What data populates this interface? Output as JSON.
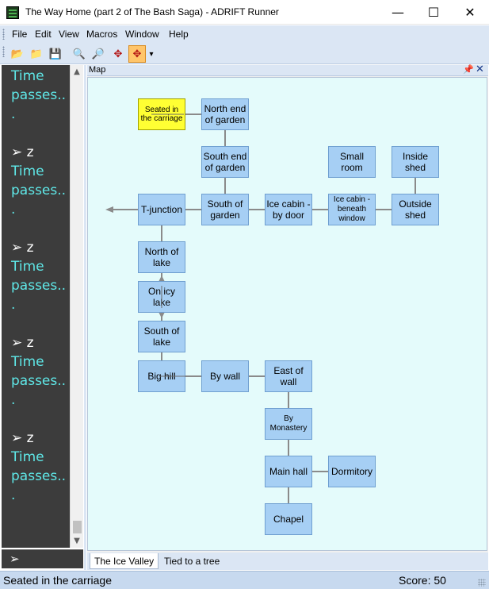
{
  "window": {
    "title": "The Way Home (part 2 of The Bash Saga) - ADRIFT Runner",
    "minimize_glyph": "—",
    "maximize_glyph": "☐",
    "close_glyph": "✕"
  },
  "menu": [
    "File",
    "Edit",
    "View",
    "Macros",
    "Window",
    "Help"
  ],
  "toolbar": {
    "buttons": [
      {
        "icon": "open-folder-icon",
        "glyph": "📂"
      },
      {
        "icon": "open-file-icon",
        "glyph": "📁"
      },
      {
        "icon": "save-icon",
        "glyph": "💾"
      },
      {
        "icon": "zoom-in-icon",
        "glyph": "🔍"
      },
      {
        "icon": "zoom-out-icon",
        "glyph": "🔎"
      },
      {
        "icon": "map-fit-icon",
        "glyph": "✥"
      },
      {
        "icon": "map-center-icon",
        "glyph": "✥"
      }
    ],
    "overflow_glyph": "▾"
  },
  "output": {
    "lines": [
      {
        "text": "Time",
        "type": "response"
      },
      {
        "text": "passes..",
        "type": "response"
      },
      {
        "text": ".",
        "type": "response"
      },
      {
        "text": "",
        "type": "blank"
      },
      {
        "text": "➢ z",
        "type": "cmd"
      },
      {
        "text": "Time",
        "type": "response"
      },
      {
        "text": "passes..",
        "type": "response"
      },
      {
        "text": ".",
        "type": "response"
      },
      {
        "text": "",
        "type": "blank"
      },
      {
        "text": "➢ z",
        "type": "cmd"
      },
      {
        "text": "Time",
        "type": "response"
      },
      {
        "text": "passes..",
        "type": "response"
      },
      {
        "text": ".",
        "type": "response"
      },
      {
        "text": "",
        "type": "blank"
      },
      {
        "text": "➢ z",
        "type": "cmd"
      },
      {
        "text": "Time",
        "type": "response"
      },
      {
        "text": "passes..",
        "type": "response"
      },
      {
        "text": ".",
        "type": "response"
      },
      {
        "text": "",
        "type": "blank"
      },
      {
        "text": "➢ z",
        "type": "cmd"
      },
      {
        "text": "Time",
        "type": "response"
      },
      {
        "text": "passes..",
        "type": "response"
      },
      {
        "text": ".",
        "type": "response"
      }
    ],
    "input_prompt": "➢",
    "scroll_up": "▲",
    "scroll_down": "▼"
  },
  "map": {
    "panel_title": "Map",
    "pin_glyph": "📌",
    "close_glyph": "✕",
    "current_room": "Seated in the carriage",
    "rooms": [
      {
        "id": "carriage",
        "name": "Seated in the carriage"
      },
      {
        "id": "north_garden",
        "name": "North end of garden"
      },
      {
        "id": "south_end_garden",
        "name": "South end of garden"
      },
      {
        "id": "small_room",
        "name": "Small room"
      },
      {
        "id": "inside_shed",
        "name": "Inside shed"
      },
      {
        "id": "t_junction",
        "name": "T-junction"
      },
      {
        "id": "south_of_garden",
        "name": "South of garden"
      },
      {
        "id": "ice_cabin_door",
        "name": "Ice cabin - by door"
      },
      {
        "id": "ice_cabin_window",
        "name": "Ice cabin - beneath window"
      },
      {
        "id": "outside_shed",
        "name": "Outside shed"
      },
      {
        "id": "north_lake",
        "name": "North of lake"
      },
      {
        "id": "on_icy_lake",
        "name": "On icy lake"
      },
      {
        "id": "south_lake",
        "name": "South of lake"
      },
      {
        "id": "big_hill",
        "name": "Big hill"
      },
      {
        "id": "by_wall",
        "name": "By wall"
      },
      {
        "id": "east_wall",
        "name": "East of wall"
      },
      {
        "id": "by_monastery",
        "name": "By Monastery"
      },
      {
        "id": "main_hall",
        "name": "Main hall"
      },
      {
        "id": "dormitory",
        "name": "Dormitory"
      },
      {
        "id": "chapel",
        "name": "Chapel"
      }
    ],
    "tabs": [
      "The Ice Valley",
      "Tied to a tree"
    ],
    "selected_tab": "The Ice Valley"
  },
  "status": {
    "location": "Seated in the carriage",
    "score": "Score: 50"
  }
}
